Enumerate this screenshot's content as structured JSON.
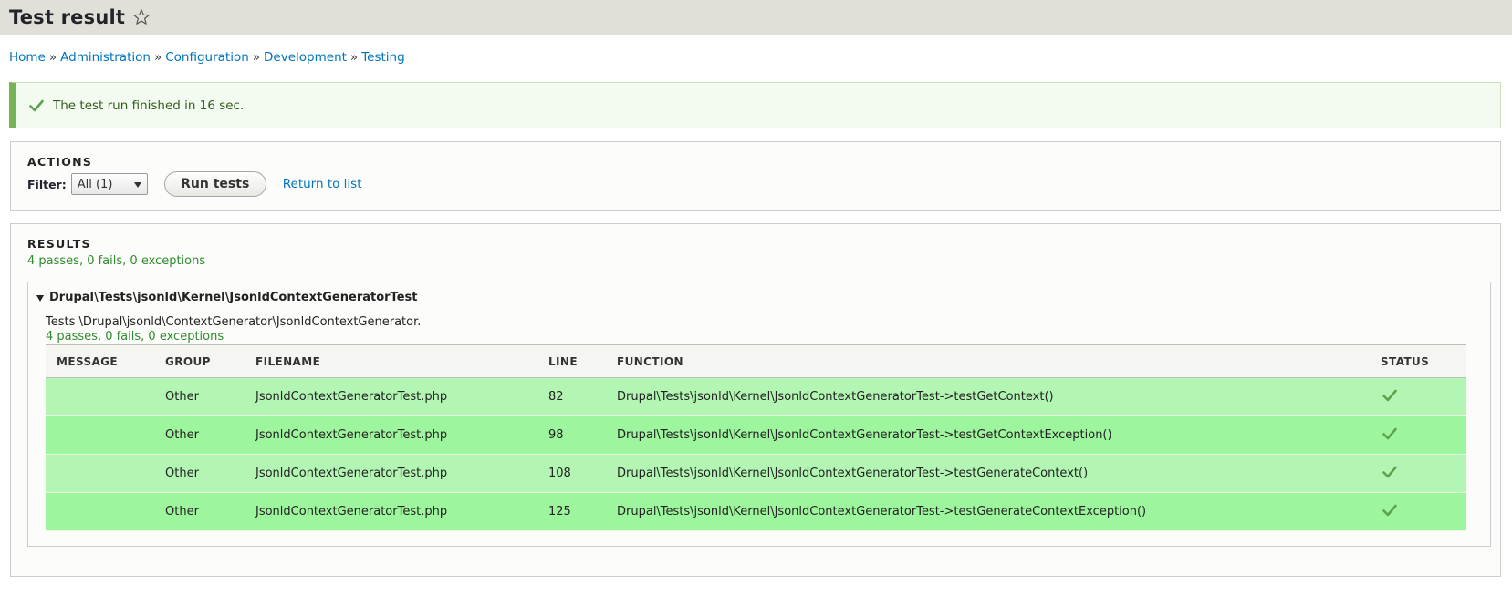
{
  "header": {
    "title": "Test result"
  },
  "breadcrumb": {
    "items": [
      "Home",
      "Administration",
      "Configuration",
      "Development",
      "Testing"
    ],
    "separator": "»"
  },
  "message": {
    "text": "The test run finished in 16 sec."
  },
  "actions": {
    "legend": "ACTIONS",
    "filter_label": "Filter:",
    "filter_value": "All (1)",
    "run_label": "Run tests",
    "return_label": "Return to list"
  },
  "results": {
    "legend": "RESULTS",
    "summary": "4 passes, 0 fails, 0 exceptions",
    "group": {
      "title": "Drupal\\Tests\\jsonld\\Kernel\\JsonldContextGeneratorTest",
      "description": "Tests \\Drupal\\jsonld\\ContextGenerator\\JsonldContextGenerator.",
      "summary": "4 passes, 0 fails, 0 exceptions",
      "columns": [
        "MESSAGE",
        "GROUP",
        "FILENAME",
        "LINE",
        "FUNCTION",
        "STATUS"
      ],
      "rows": [
        {
          "message": "",
          "group": "Other",
          "filename": "JsonldContextGeneratorTest.php",
          "line": "82",
          "function": "Drupal\\Tests\\jsonld\\Kernel\\JsonldContextGeneratorTest->testGetContext()",
          "status": "pass"
        },
        {
          "message": "",
          "group": "Other",
          "filename": "JsonldContextGeneratorTest.php",
          "line": "98",
          "function": "Drupal\\Tests\\jsonld\\Kernel\\JsonldContextGeneratorTest->testGetContextException()",
          "status": "pass"
        },
        {
          "message": "",
          "group": "Other",
          "filename": "JsonldContextGeneratorTest.php",
          "line": "108",
          "function": "Drupal\\Tests\\jsonld\\Kernel\\JsonldContextGeneratorTest->testGenerateContext()",
          "status": "pass"
        },
        {
          "message": "",
          "group": "Other",
          "filename": "JsonldContextGeneratorTest.php",
          "line": "125",
          "function": "Drupal\\Tests\\jsonld\\Kernel\\JsonldContextGeneratorTest->testGenerateContextException()",
          "status": "pass"
        }
      ]
    }
  },
  "colors": {
    "link": "#0074bd",
    "pass_text": "#2e8b2e",
    "row_light": "#b3f6b3",
    "row_dark": "#9df59d",
    "status_check": "#5fa24a"
  },
  "icons": [
    "star-icon",
    "check-icon",
    "triangle-down-icon",
    "status-pass-icon"
  ]
}
